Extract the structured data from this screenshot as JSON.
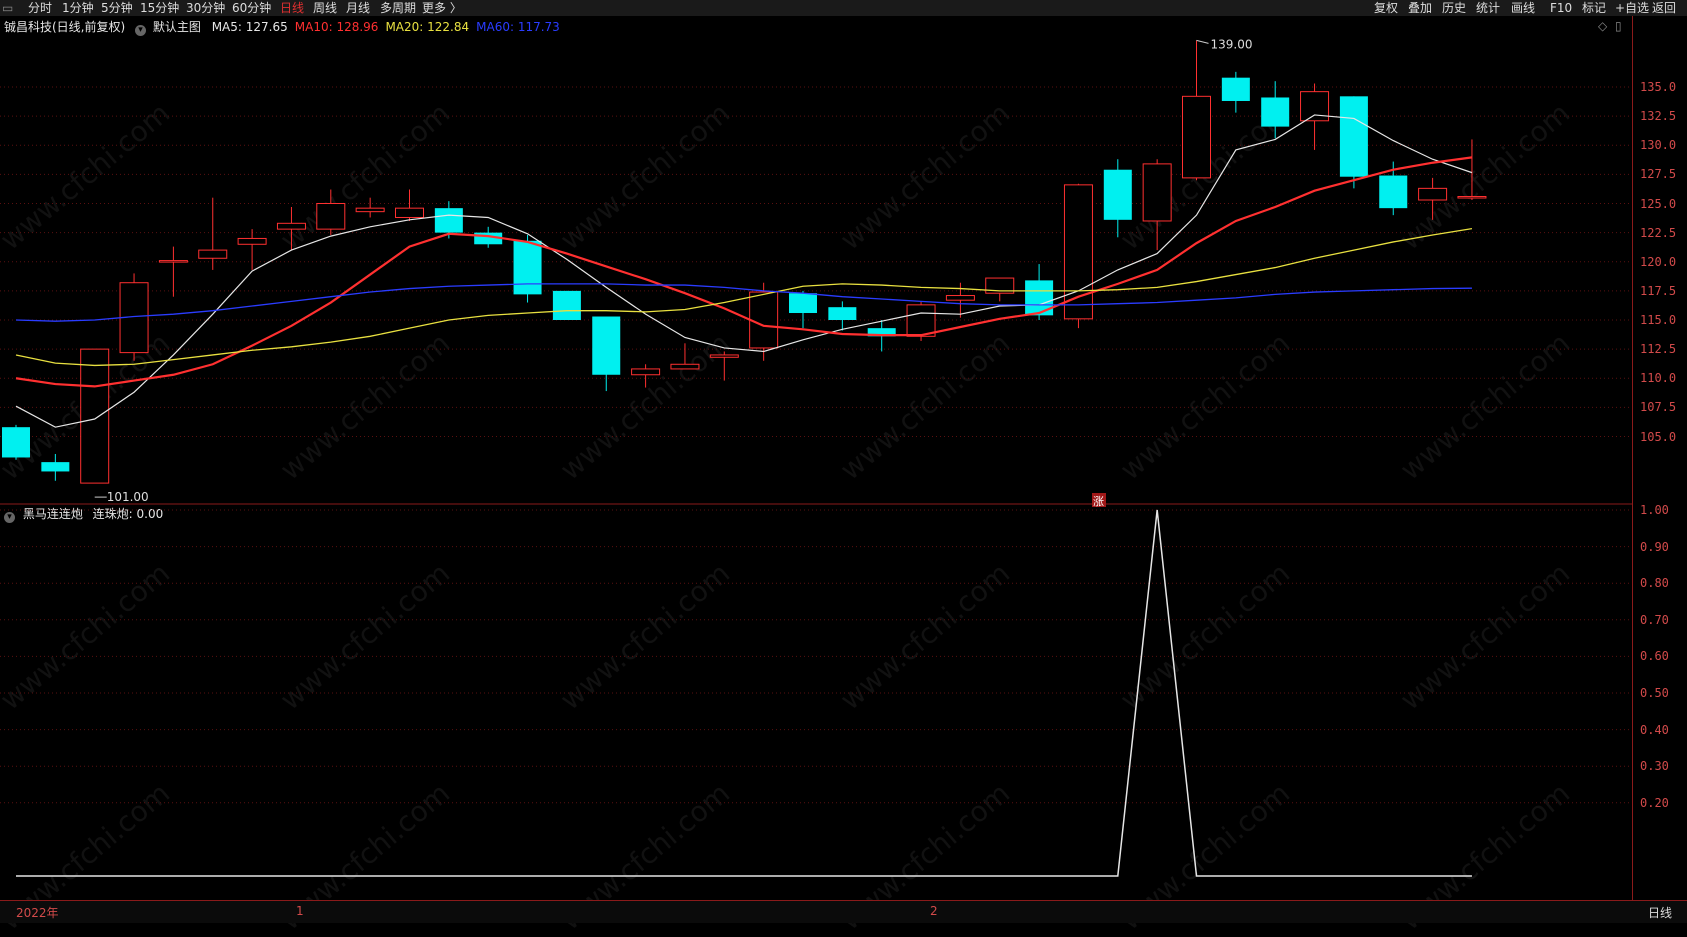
{
  "toolbar": {
    "periods": [
      {
        "label": "分时",
        "active": false
      },
      {
        "label": "1分钟",
        "active": false
      },
      {
        "label": "5分钟",
        "active": false
      },
      {
        "label": "15分钟",
        "active": false
      },
      {
        "label": "30分钟",
        "active": false
      },
      {
        "label": "60分钟",
        "active": false
      },
      {
        "label": "日线",
        "active": true
      },
      {
        "label": "周线",
        "active": false
      },
      {
        "label": "月线",
        "active": false
      },
      {
        "label": "多周期",
        "active": false
      },
      {
        "label": "更多 〉",
        "active": false
      }
    ],
    "right_buttons": [
      "复权",
      "叠加",
      "历史",
      "统计",
      "画线",
      "F10",
      "标记",
      "+自选",
      "返回"
    ]
  },
  "main_panel": {
    "stock": "铖昌科技(日线,前复权)",
    "template": "默认主图",
    "ma": [
      {
        "label": "MA5:",
        "value": "127.65",
        "color": "#e6e6e6"
      },
      {
        "label": "MA10:",
        "value": "128.96",
        "color": "#ff3030"
      },
      {
        "label": "MA20:",
        "value": "122.84",
        "color": "#e8e040"
      },
      {
        "label": "MA60:",
        "value": "117.73",
        "color": "#2a3cff"
      }
    ],
    "high_label": "139.00",
    "low_label": "101.00",
    "marker": "涨"
  },
  "sub_panel": {
    "indicator": "黑马连连炮",
    "value_label": "连珠炮: 0.00"
  },
  "bottom": {
    "year_label": "2022年",
    "month_labels": [
      "1",
      "2"
    ],
    "right_label": "日线"
  },
  "watermark": "www.cfchi.com",
  "chart_data": [
    {
      "type": "candlestick",
      "title": "铖昌科技(日线,前复权)",
      "ylim": [
        101,
        139
      ],
      "yticks": [
        105.0,
        107.5,
        110.0,
        112.5,
        115.0,
        117.5,
        120.0,
        122.5,
        125.0,
        127.5,
        130.0,
        132.5,
        135.0
      ],
      "candles": [
        {
          "o": 105.8,
          "h": 106.0,
          "c": 103.2,
          "l": 103.0
        },
        {
          "o": 102.8,
          "h": 103.5,
          "c": 102.0,
          "l": 101.2
        },
        {
          "o": 101.0,
          "h": 112.5,
          "c": 112.5,
          "l": 101.0
        },
        {
          "o": 112.2,
          "h": 119.0,
          "c": 118.2,
          "l": 111.5
        },
        {
          "o": 120.0,
          "h": 121.3,
          "c": 120.1,
          "l": 117.0
        },
        {
          "o": 120.3,
          "h": 125.5,
          "c": 121.0,
          "l": 119.3
        },
        {
          "o": 121.5,
          "h": 122.8,
          "c": 122.0,
          "l": 119.3
        },
        {
          "o": 122.8,
          "h": 124.7,
          "c": 123.3,
          "l": 121.0
        },
        {
          "o": 122.8,
          "h": 126.2,
          "c": 125.0,
          "l": 122.3
        },
        {
          "o": 124.3,
          "h": 125.5,
          "c": 124.6,
          "l": 123.8
        },
        {
          "o": 123.8,
          "h": 126.2,
          "c": 124.6,
          "l": 123.5
        },
        {
          "o": 124.6,
          "h": 125.2,
          "c": 122.5,
          "l": 122.0
        },
        {
          "o": 122.5,
          "h": 123.0,
          "c": 121.5,
          "l": 121.2
        },
        {
          "o": 121.8,
          "h": 122.3,
          "c": 117.2,
          "l": 116.5
        },
        {
          "o": 117.5,
          "h": 117.5,
          "c": 115.0,
          "l": 115.0
        },
        {
          "o": 115.3,
          "h": 115.3,
          "c": 110.3,
          "l": 108.9
        },
        {
          "o": 110.3,
          "h": 111.2,
          "c": 110.8,
          "l": 109.2
        },
        {
          "o": 110.8,
          "h": 113.0,
          "c": 111.2,
          "l": 110.8
        },
        {
          "o": 111.8,
          "h": 112.3,
          "c": 112.0,
          "l": 109.8
        },
        {
          "o": 112.6,
          "h": 118.2,
          "c": 117.4,
          "l": 111.5
        },
        {
          "o": 117.3,
          "h": 117.5,
          "c": 115.6,
          "l": 114.3
        },
        {
          "o": 116.1,
          "h": 116.6,
          "c": 115.0,
          "l": 114.1
        },
        {
          "o": 114.3,
          "h": 115.0,
          "c": 113.6,
          "l": 112.3
        },
        {
          "o": 113.6,
          "h": 116.6,
          "c": 116.3,
          "l": 113.2
        },
        {
          "o": 116.7,
          "h": 118.2,
          "c": 117.1,
          "l": 115.2
        },
        {
          "o": 117.3,
          "h": 118.5,
          "c": 118.6,
          "l": 116.6
        },
        {
          "o": 118.4,
          "h": 119.8,
          "c": 115.4,
          "l": 115.0
        },
        {
          "o": 115.1,
          "h": 126.7,
          "c": 126.6,
          "l": 114.3
        },
        {
          "o": 127.9,
          "h": 128.8,
          "c": 123.6,
          "l": 122.1
        },
        {
          "o": 123.5,
          "h": 128.8,
          "c": 128.4,
          "l": 121.0
        },
        {
          "o": 127.2,
          "h": 139.0,
          "c": 134.2,
          "l": 127.0
        },
        {
          "o": 135.8,
          "h": 136.3,
          "c": 133.8,
          "l": 132.8
        },
        {
          "o": 134.1,
          "h": 135.5,
          "c": 131.6,
          "l": 130.6
        },
        {
          "o": 132.1,
          "h": 135.3,
          "c": 134.6,
          "l": 129.6
        },
        {
          "o": 134.2,
          "h": 134.2,
          "c": 127.3,
          "l": 126.3
        },
        {
          "o": 127.4,
          "h": 128.6,
          "c": 124.6,
          "l": 124.0
        },
        {
          "o": 125.3,
          "h": 127.2,
          "c": 126.3,
          "l": 123.6
        },
        {
          "o": 125.6,
          "h": 130.5,
          "c": 125.6,
          "l": 125.3
        }
      ],
      "series": [
        {
          "name": "MA5",
          "color": "#e6e6e6",
          "values": [
            107.6,
            105.8,
            106.5,
            108.8,
            112.0,
            115.5,
            119.2,
            121.0,
            122.2,
            123.0,
            123.6,
            124.0,
            123.8,
            122.4,
            120.2,
            117.8,
            115.5,
            113.5,
            112.6,
            112.3,
            113.3,
            114.2,
            114.9,
            115.6,
            115.5,
            116.2,
            116.3,
            117.5,
            119.3,
            120.7,
            124.0,
            129.6,
            130.5,
            132.6,
            132.3,
            130.4,
            128.8,
            127.65
          ]
        },
        {
          "name": "MA10",
          "color": "#ff3030",
          "values": [
            110.0,
            109.5,
            109.3,
            109.8,
            110.3,
            111.2,
            112.8,
            114.5,
            116.5,
            118.9,
            121.3,
            122.4,
            122.2,
            121.7,
            120.7,
            119.6,
            118.5,
            117.3,
            116.0,
            114.5,
            114.2,
            113.8,
            113.7,
            113.7,
            114.4,
            115.1,
            115.6,
            117.0,
            118.1,
            119.3,
            121.6,
            123.5,
            124.7,
            126.1,
            127.0,
            127.9,
            128.5,
            128.96
          ]
        },
        {
          "name": "MA20",
          "color": "#e8e040",
          "values": [
            112.0,
            111.3,
            111.1,
            111.2,
            111.6,
            112.0,
            112.4,
            112.7,
            113.1,
            113.6,
            114.3,
            115.0,
            115.4,
            115.6,
            115.8,
            115.8,
            115.7,
            115.9,
            116.5,
            117.2,
            117.9,
            118.1,
            118.0,
            117.8,
            117.7,
            117.5,
            117.5,
            117.5,
            117.6,
            117.8,
            118.3,
            118.9,
            119.5,
            120.3,
            121.0,
            121.7,
            122.3,
            122.84
          ]
        },
        {
          "name": "MA60",
          "color": "#2a3cff",
          "values": [
            115.0,
            114.9,
            115.0,
            115.3,
            115.5,
            115.8,
            116.2,
            116.6,
            117.0,
            117.4,
            117.7,
            117.9,
            118.0,
            118.1,
            118.1,
            118.1,
            118.0,
            118.0,
            117.8,
            117.5,
            117.3,
            117.0,
            116.8,
            116.6,
            116.4,
            116.3,
            116.3,
            116.3,
            116.4,
            116.5,
            116.7,
            116.9,
            117.2,
            117.4,
            117.5,
            117.6,
            117.7,
            117.73
          ]
        }
      ]
    },
    {
      "type": "line",
      "title": "黑马连连炮",
      "ylim": [
        0,
        1
      ],
      "yticks": [
        0.2,
        0.3,
        0.4,
        0.5,
        0.6,
        0.7,
        0.8,
        0.9,
        1.0
      ],
      "series": [
        {
          "name": "连珠炮",
          "color": "#e6e6e6",
          "values": [
            0,
            0,
            0,
            0,
            0,
            0,
            0,
            0,
            0,
            0,
            0,
            0,
            0,
            0,
            0,
            0,
            0,
            0,
            0,
            0,
            0,
            0,
            0,
            0,
            0,
            0,
            0,
            0,
            0,
            1,
            0,
            0,
            0,
            0,
            0,
            0,
            0,
            0
          ]
        }
      ]
    }
  ]
}
